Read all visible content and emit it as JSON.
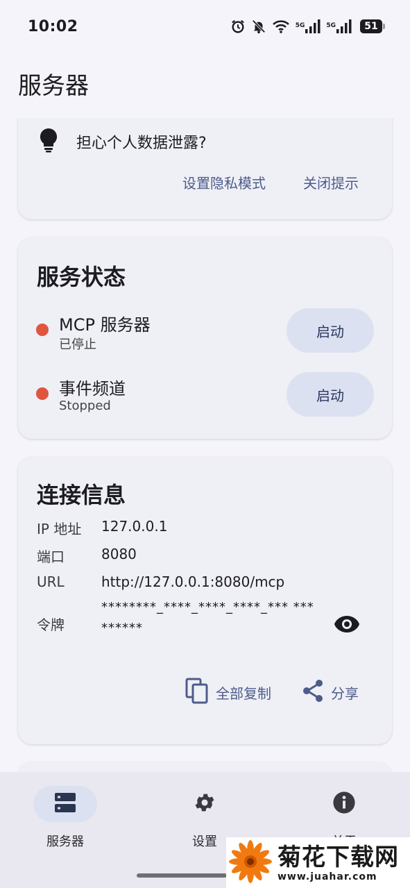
{
  "status_bar": {
    "time": "10:02",
    "battery": "51",
    "signal_labels": [
      "5G",
      "5G"
    ]
  },
  "app_bar": {
    "title": "服务器"
  },
  "privacy_card": {
    "message": "担心个人数据泄露?",
    "set_privacy_mode": "设置隐私模式",
    "close_tip": "关闭提示"
  },
  "service_status": {
    "title": "服务状态",
    "services": [
      {
        "name": "MCP 服务器",
        "state": "已停止",
        "action": "启动"
      },
      {
        "name": "事件频道",
        "state": "Stopped",
        "action": "启动"
      }
    ],
    "dot_color": "#e05540"
  },
  "connection_info": {
    "title": "连接信息",
    "ip_label": "IP 地址",
    "ip_value": "127.0.0.1",
    "port_label": "端口",
    "port_value": "8080",
    "url_label": "URL",
    "url_value": "http://127.0.0.1:8080/mcp",
    "token_label": "令牌",
    "token_value": "********_****_****_****_*** *********",
    "copy_all": "全部复制",
    "share": "分享"
  },
  "bottom_nav": {
    "items": [
      {
        "label": "服务器",
        "icon": "server-icon",
        "active": true
      },
      {
        "label": "设置",
        "icon": "gear-icon",
        "active": false
      },
      {
        "label": "关于",
        "icon": "info-icon",
        "active": false
      }
    ]
  },
  "watermark": {
    "title": "菊花下载网",
    "url": "www.juahar.com"
  }
}
